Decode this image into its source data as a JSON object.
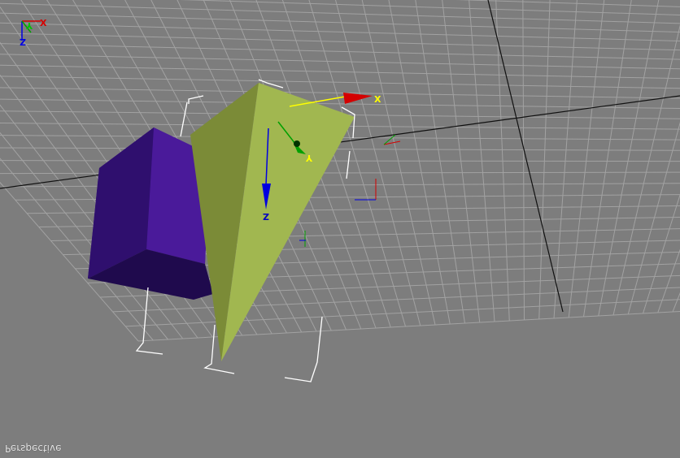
{
  "viewport": {
    "label": "Perspective"
  },
  "colors": {
    "background": "#7d7d7d",
    "grid_line": "#a2a2a2",
    "grid_major": "#101010",
    "box_front": "#3f1589",
    "box_side": "#2d0e66",
    "box_bottom": "#1c0848",
    "pyramid_light": "#a1b750",
    "pyramid_dark": "#7b8b37",
    "axis_x": "#d40000",
    "axis_y": "#00a000",
    "axis_z": "#0000e0",
    "selection_bracket": "#ffffff",
    "highlight_axis": "#ffff00"
  },
  "gizmo": {
    "x_label": "X",
    "y_label": "Y",
    "z_label": "Z"
  },
  "corner_axis": {
    "x_label": "X",
    "y_label": "Y",
    "z_label": "Z"
  }
}
